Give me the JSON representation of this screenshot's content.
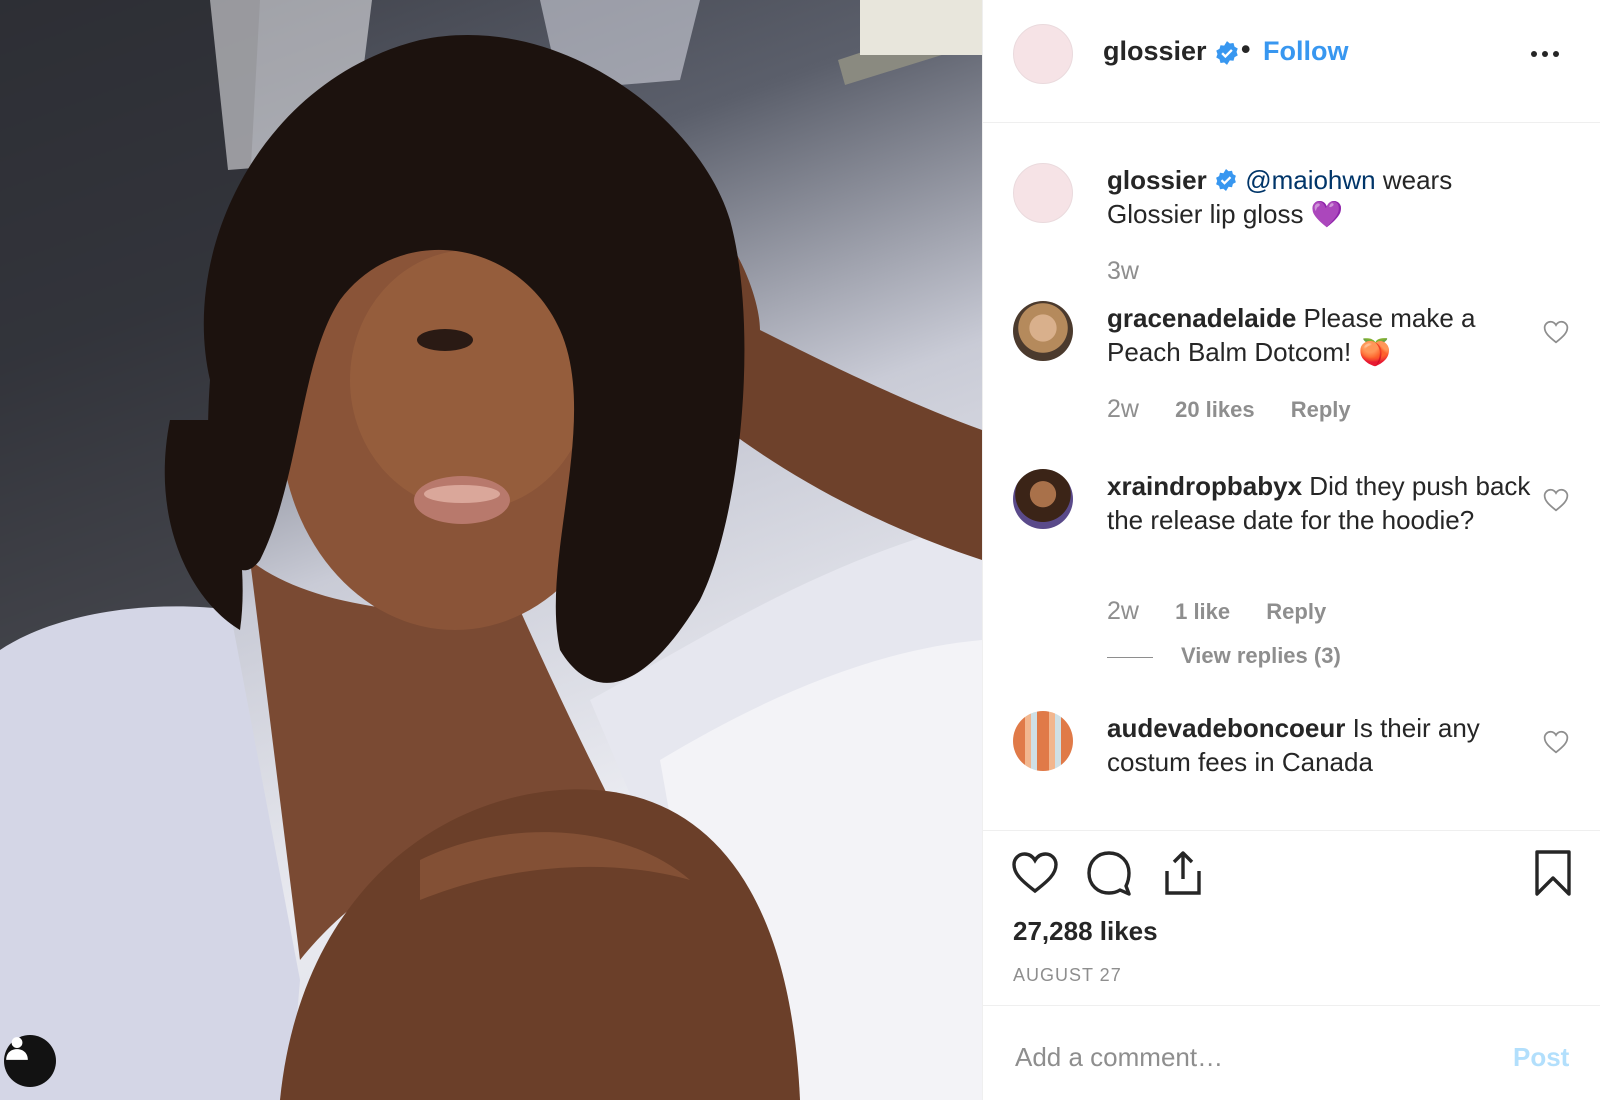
{
  "post": {
    "username": "glossier",
    "follow_label": "Follow",
    "dot": "•",
    "more_icon": "more-horizontal-icon",
    "caption": {
      "username": "glossier",
      "mention": "@maiohwn",
      "text": " wears Glossier lip gloss ",
      "emoji": "💜",
      "time": "3w"
    },
    "comments": [
      {
        "username": "gracenadelaide",
        "text": " Please make a Peach Balm Dotcom! ",
        "emoji": "🍑",
        "time": "2w",
        "likes": "20 likes",
        "reply": "Reply"
      },
      {
        "username": "xraindropbabyx",
        "text": " Did they push back the release date for the hoodie?",
        "time": "2w",
        "likes": "1 like",
        "reply": "Reply",
        "view_replies": "View replies (3)"
      },
      {
        "username": "audevadeboncoeur",
        "text": " Is their any costum fees in Canada"
      }
    ],
    "likes_count": "27,288 likes",
    "date": "AUGUST 27",
    "comment_placeholder": "Add a comment…",
    "post_label": "Post"
  },
  "colors": {
    "link_blue": "#3897f0",
    "mention_blue": "#003569",
    "muted_gray": "#8e8e8e",
    "post_disabled": "#b2dffc",
    "avatar_pink": "#f6e3e6"
  }
}
